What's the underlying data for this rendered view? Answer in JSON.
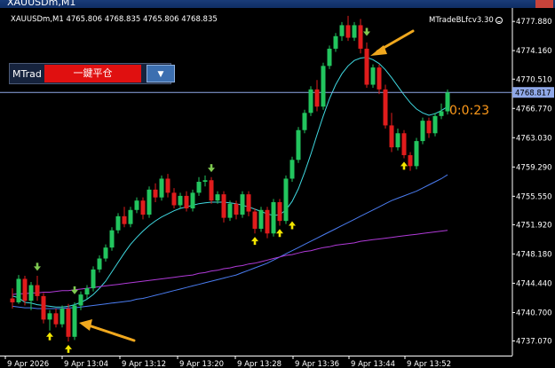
{
  "window": {
    "title": "XAUUSDm,M1"
  },
  "header": {
    "symbol_line": "XAUUSDm,M1  4765.806 4768.835 4765.806 4768.835"
  },
  "indicator": {
    "ea_name": "MTradeBLfcv3.30",
    "icon": "smile-icon"
  },
  "countdown": "0:0:23",
  "panel": {
    "label": "MTrad",
    "close_all_button": "一鍵平仓",
    "dropdown_glyph": "▼"
  },
  "colors": {
    "bull": "#22c55e",
    "bear": "#e01c1c",
    "ma_fast": "#3fd8e0",
    "ma_mid": "#4a7cf0",
    "ma_slow": "#b03ad8",
    "bid_line": "#8fa8e8",
    "up_arrow": "#f3e600",
    "down_arrow": "#7ec850",
    "annotation": "#f0a81e"
  },
  "chart_data": {
    "type": "candlestick",
    "symbol": "XAUUSDm",
    "timeframe": "M1",
    "ylim": [
      4735.2,
      4779.6
    ],
    "y_ticks": [
      4777.88,
      4774.16,
      4770.51,
      4766.77,
      4763.03,
      4759.29,
      4755.55,
      4751.92,
      4748.18,
      4744.44,
      4740.7,
      4737.07
    ],
    "y_tick_labels": [
      "4777.880",
      "4774.160",
      "4770.510",
      "4766.770",
      "4763.030",
      "4759.290",
      "4755.550",
      "4751.920",
      "4748.180",
      "4744.440",
      "4740.700",
      "4737.070"
    ],
    "x_tick_labels": [
      "9 Apr 2026",
      "9 Apr 13:04",
      "9 Apr 13:12",
      "9 Apr 13:20",
      "9 Apr 13:28",
      "9 Apr 13:36",
      "9 Apr 13:44",
      "9 Apr 13:52"
    ],
    "current_price": 4768.817,
    "current_price_label": "4768.817",
    "candles": [
      [
        4742.5,
        4743.8,
        4741.2,
        4742.0
      ],
      [
        4742.0,
        4745.5,
        4741.8,
        4745.0
      ],
      [
        4745.0,
        4745.4,
        4741.6,
        4742.2
      ],
      [
        4742.2,
        4744.6,
        4741.0,
        4744.2
      ],
      [
        4744.2,
        4745.4,
        4742.2,
        4742.8
      ],
      [
        4742.8,
        4743.2,
        4739.3,
        4739.8
      ],
      [
        4739.8,
        4741.0,
        4738.4,
        4740.6
      ],
      [
        4740.6,
        4741.2,
        4738.8,
        4739.2
      ],
      [
        4739.2,
        4741.6,
        4738.8,
        4741.2
      ],
      [
        4741.2,
        4741.8,
        4737.0,
        4737.6
      ],
      [
        4737.6,
        4742.0,
        4737.2,
        4741.6
      ],
      [
        4741.6,
        4743.4,
        4741.0,
        4743.0
      ],
      [
        4743.0,
        4744.2,
        4742.4,
        4743.8
      ],
      [
        4743.8,
        4746.6,
        4743.4,
        4746.2
      ],
      [
        4746.2,
        4748.0,
        4745.8,
        4747.6
      ],
      [
        4747.6,
        4749.4,
        4747.2,
        4749.0
      ],
      [
        4749.0,
        4751.6,
        4748.6,
        4751.2
      ],
      [
        4751.2,
        4753.4,
        4750.8,
        4753.0
      ],
      [
        4753.0,
        4754.2,
        4751.6,
        4752.0
      ],
      [
        4752.0,
        4754.2,
        4751.6,
        4753.8
      ],
      [
        4753.8,
        4755.4,
        4753.4,
        4755.0
      ],
      [
        4755.0,
        4755.4,
        4752.6,
        4753.2
      ],
      [
        4753.2,
        4756.8,
        4752.8,
        4756.4
      ],
      [
        4756.4,
        4757.2,
        4754.8,
        4755.4
      ],
      [
        4755.4,
        4758.2,
        4755.0,
        4757.8
      ],
      [
        4757.8,
        4758.4,
        4755.4,
        4756.0
      ],
      [
        4756.0,
        4756.6,
        4754.0,
        4754.4
      ],
      [
        4754.4,
        4756.0,
        4754.0,
        4755.6
      ],
      [
        4755.6,
        4756.2,
        4753.6,
        4754.0
      ],
      [
        4754.0,
        4756.4,
        4753.6,
        4756.0
      ],
      [
        4756.0,
        4758.0,
        4755.6,
        4757.4
      ],
      [
        4757.4,
        4758.2,
        4756.8,
        4757.6
      ],
      [
        4757.6,
        4758.0,
        4754.6,
        4755.0
      ],
      [
        4755.0,
        4756.2,
        4754.6,
        4755.8
      ],
      [
        4755.8,
        4756.2,
        4752.2,
        4752.8
      ],
      [
        4752.8,
        4755.0,
        4752.4,
        4754.6
      ],
      [
        4754.6,
        4755.0,
        4752.6,
        4753.2
      ],
      [
        4753.2,
        4756.2,
        4752.8,
        4755.8
      ],
      [
        4755.8,
        4756.2,
        4753.0,
        4753.6
      ],
      [
        4753.6,
        4754.0,
        4750.8,
        4751.4
      ],
      [
        4751.4,
        4754.2,
        4751.0,
        4753.8
      ],
      [
        4753.8,
        4754.2,
        4750.2,
        4750.8
      ],
      [
        4750.8,
        4755.2,
        4750.4,
        4754.8
      ],
      [
        4754.8,
        4755.2,
        4751.8,
        4752.4
      ],
      [
        4752.4,
        4758.2,
        4752.0,
        4757.8
      ],
      [
        4757.8,
        4760.6,
        4757.4,
        4760.2
      ],
      [
        4760.2,
        4764.4,
        4759.8,
        4764.0
      ],
      [
        4764.0,
        4766.6,
        4763.6,
        4766.2
      ],
      [
        4766.2,
        4769.6,
        4765.8,
        4769.2
      ],
      [
        4769.2,
        4770.4,
        4766.4,
        4767.0
      ],
      [
        4767.0,
        4772.6,
        4766.6,
        4772.2
      ],
      [
        4772.2,
        4774.8,
        4771.8,
        4774.4
      ],
      [
        4774.4,
        4776.4,
        4774.0,
        4776.0
      ],
      [
        4776.0,
        4777.8,
        4775.4,
        4777.4
      ],
      [
        4777.4,
        4778.6,
        4775.4,
        4775.8
      ],
      [
        4775.8,
        4777.8,
        4775.4,
        4777.4
      ],
      [
        4777.4,
        4778.2,
        4773.8,
        4774.4
      ],
      [
        4774.4,
        4775.2,
        4769.4,
        4769.8
      ],
      [
        4769.8,
        4772.4,
        4769.4,
        4772.0
      ],
      [
        4772.0,
        4772.4,
        4768.6,
        4769.2
      ],
      [
        4769.2,
        4769.8,
        4764.2,
        4764.6
      ],
      [
        4764.6,
        4766.2,
        4761.2,
        4761.8
      ],
      [
        4761.8,
        4764.2,
        4761.4,
        4763.6
      ],
      [
        4763.6,
        4764.0,
        4760.4,
        4760.8
      ],
      [
        4760.8,
        4761.2,
        4758.8,
        4759.4
      ],
      [
        4759.4,
        4763.0,
        4759.0,
        4762.6
      ],
      [
        4762.6,
        4765.6,
        4762.2,
        4765.2
      ],
      [
        4765.2,
        4765.6,
        4763.0,
        4763.6
      ],
      [
        4763.6,
        4766.2,
        4763.2,
        4765.8
      ],
      [
        4765.8,
        4767.4,
        4765.4,
        4766.4
      ],
      [
        4766.4,
        4769.2,
        4766.0,
        4768.8
      ]
    ],
    "moving_averages": [
      {
        "label": "fast",
        "color": "#3fd8e0",
        "values": [
          4742.8,
          4742.6,
          4742.0,
          4741.9,
          4741.7,
          4741.6,
          4741.5,
          4741.4,
          4741.4,
          4741.5,
          4741.7,
          4742.0,
          4742.4,
          4743.0,
          4743.8,
          4744.7,
          4745.9,
          4747.1,
          4748.3,
          4749.4,
          4750.3,
          4751.1,
          4751.8,
          4752.4,
          4752.9,
          4753.3,
          4753.7,
          4754.0,
          4754.2,
          4754.4,
          4754.6,
          4754.7,
          4754.8,
          4754.8,
          4754.8,
          4754.7,
          4754.6,
          4754.4,
          4754.2,
          4753.9,
          4753.6,
          4753.3,
          4753.1,
          4753.2,
          4753.8,
          4754.9,
          4756.5,
          4758.6,
          4760.9,
          4763.4,
          4765.8,
          4768.0,
          4769.8,
          4771.2,
          4772.2,
          4772.9,
          4773.2,
          4773.3,
          4773.0,
          4772.5,
          4771.7,
          4770.7,
          4769.6,
          4768.5,
          4767.5,
          4766.7,
          4766.2,
          4765.9,
          4766.1,
          4766.5,
          4767.0
        ]
      },
      {
        "label": "mid",
        "color": "#4a7cf0",
        "values": [
          4741.5,
          4741.4,
          4741.3,
          4741.3,
          4741.2,
          4741.2,
          4741.2,
          4741.2,
          4741.2,
          4741.3,
          4741.3,
          4741.4,
          4741.5,
          4741.6,
          4741.7,
          4741.8,
          4741.9,
          4742.0,
          4742.1,
          4742.2,
          4742.4,
          4742.5,
          4742.7,
          4742.9,
          4743.1,
          4743.3,
          4743.5,
          4743.7,
          4743.9,
          4744.1,
          4744.3,
          4744.5,
          4744.7,
          4744.9,
          4745.1,
          4745.3,
          4745.5,
          4745.8,
          4746.1,
          4746.4,
          4746.7,
          4747.0,
          4747.4,
          4747.8,
          4748.2,
          4748.6,
          4749.0,
          4749.4,
          4749.8,
          4750.2,
          4750.6,
          4751.0,
          4751.4,
          4751.8,
          4752.2,
          4752.6,
          4753.0,
          4753.4,
          4753.8,
          4754.2,
          4754.6,
          4755.0,
          4755.3,
          4755.6,
          4755.9,
          4756.2,
          4756.6,
          4757.0,
          4757.4,
          4757.8,
          4758.3
        ]
      },
      {
        "label": "slow",
        "color": "#b03ad8",
        "values": [
          4743.0,
          4743.1,
          4743.1,
          4743.2,
          4743.2,
          4743.3,
          4743.3,
          4743.4,
          4743.5,
          4743.5,
          4743.6,
          4743.7,
          4743.8,
          4743.9,
          4744.0,
          4744.1,
          4744.2,
          4744.3,
          4744.4,
          4744.5,
          4744.6,
          4744.7,
          4744.8,
          4744.9,
          4745.0,
          4745.1,
          4745.2,
          4745.3,
          4745.4,
          4745.5,
          4745.7,
          4745.8,
          4746.0,
          4746.1,
          4746.3,
          4746.4,
          4746.6,
          4746.7,
          4746.9,
          4747.0,
          4747.2,
          4747.4,
          4747.6,
          4747.8,
          4748.0,
          4748.1,
          4748.3,
          4748.5,
          4748.6,
          4748.8,
          4749.0,
          4749.1,
          4749.3,
          4749.4,
          4749.5,
          4749.6,
          4749.8,
          4749.9,
          4750.0,
          4750.1,
          4750.2,
          4750.3,
          4750.4,
          4750.5,
          4750.6,
          4750.7,
          4750.8,
          4750.9,
          4751.0,
          4751.1,
          4751.2
        ]
      }
    ],
    "signal_arrows": [
      {
        "index": 4,
        "direction": "down",
        "price": 4746.6
      },
      {
        "index": 6,
        "direction": "up",
        "price": 4737.6
      },
      {
        "index": 9,
        "direction": "up",
        "price": 4736.0
      },
      {
        "index": 10,
        "direction": "down",
        "price": 4743.6
      },
      {
        "index": 32,
        "direction": "down",
        "price": 4759.2
      },
      {
        "index": 39,
        "direction": "up",
        "price": 4749.8
      },
      {
        "index": 43,
        "direction": "up",
        "price": 4750.8
      },
      {
        "index": 45,
        "direction": "up",
        "price": 4751.8
      },
      {
        "index": 57,
        "direction": "down",
        "price": 4776.6
      },
      {
        "index": 63,
        "direction": "up",
        "price": 4759.4
      }
    ]
  }
}
